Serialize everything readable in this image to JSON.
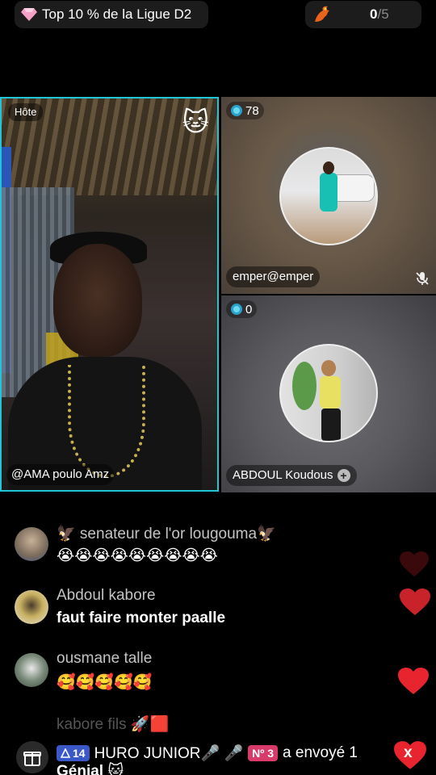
{
  "top_bar": {
    "league_badge": "Top 10 % de la Ligue D2",
    "guest_count": "0",
    "guest_total": "/5"
  },
  "host": {
    "role_label": "Hôte",
    "name": "@AMA poulo Amz"
  },
  "guests": [
    {
      "coins": "78",
      "name": "emper@emper",
      "mic_muted": true
    },
    {
      "coins": "0",
      "name": "ABDOUL Koudous",
      "mic_muted": false
    }
  ],
  "comments": [
    {
      "user": "🦅 senateur de l'or lougouma🦅",
      "message": "😭😭😭😭😭😭😭😭😭"
    },
    {
      "user": "Abdoul kabore",
      "message": "faut faire monter paalle"
    },
    {
      "user": "ousmane talle",
      "message": "🥰🥰🥰🥰🥰"
    },
    {
      "user": "kabore fils 🚀🟥",
      "message": ""
    }
  ],
  "gift_notice": {
    "level": "14",
    "sender": "HURO JUNIOR🎤 🎤",
    "rank": "Nº 3",
    "action": "a envoyé 1",
    "close_label": "x",
    "gift_name": "Génial 🐱"
  },
  "colors": {
    "host_border": "#20c5d8",
    "heart": "#e8252e",
    "level_badge": "#3a58c8",
    "rank_badge": "#d83a6a"
  }
}
